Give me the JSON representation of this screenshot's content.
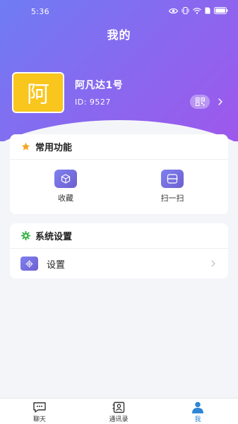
{
  "status_bar": {
    "time": "5:36",
    "icons": [
      "eye-icon",
      "vibrate-icon",
      "wifi-icon",
      "sim-icon",
      "battery-icon"
    ]
  },
  "header": {
    "title": "我的"
  },
  "profile": {
    "avatar_text": "阿",
    "username": "阿凡达1号",
    "id_text": "ID:  9527",
    "qr_icon": "qr-code-icon",
    "chevron_icon": "chevron-right-icon"
  },
  "common_functions": {
    "title": "常用功能",
    "title_icon": "star-icon",
    "items": [
      {
        "label": "收藏",
        "icon": "cube-icon"
      },
      {
        "label": "扫一扫",
        "icon": "scan-icon"
      }
    ]
  },
  "system_settings": {
    "title": "系统设置",
    "title_icon": "gear-icon",
    "items": [
      {
        "label": "设置",
        "icon": "gear-icon"
      }
    ]
  },
  "tabbar": {
    "items": [
      {
        "label": "聊天",
        "icon": "chat-icon",
        "active": false
      },
      {
        "label": "通讯录",
        "icon": "contacts-icon",
        "active": false
      },
      {
        "label": "我",
        "icon": "person-icon",
        "active": true
      }
    ]
  },
  "colors": {
    "header_gradient_start": "#6f7cf3",
    "header_gradient_end": "#9e58ec",
    "avatar_bg": "#f8c61c",
    "star": "#f5a623",
    "gear_green": "#3bb54a",
    "active_tab": "#2f86d6",
    "icon_purple": "#7472e8"
  }
}
